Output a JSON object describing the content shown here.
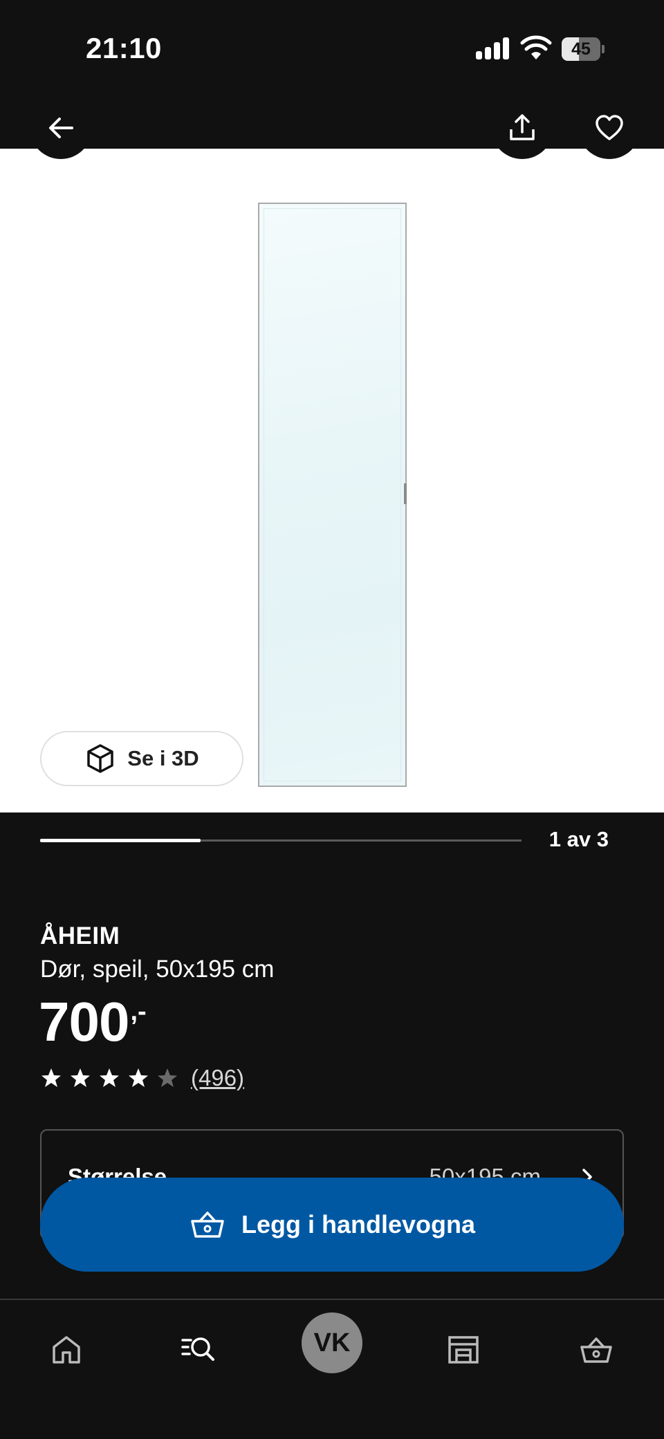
{
  "status_bar": {
    "time": "21:10",
    "battery_level": "45",
    "battery_fraction": 0.45,
    "icons": [
      "signal-icon",
      "wifi-icon",
      "battery-icon"
    ]
  },
  "top_nav": {
    "back_icon": "arrow-left-icon",
    "share_icon": "share-icon",
    "favorite_icon": "heart-icon"
  },
  "gallery": {
    "view_3d_label": "Se i 3D",
    "view_3d_icon": "cube-icon",
    "pager_text": "1 av 3",
    "current_index": 1,
    "total": 3
  },
  "product": {
    "name": "ÅHEIM",
    "description": "Dør, speil, 50x195 cm",
    "price": "700",
    "price_suffix": ",-",
    "rating": 4,
    "rating_max": 5,
    "reviews_count": "(496)"
  },
  "size_selector": {
    "label": "Størrelse",
    "value": "50x195 cm"
  },
  "add_to_cart": {
    "label": "Legg i handlevogna",
    "icon": "basket-icon"
  },
  "bottom_nav": {
    "items": [
      {
        "name": "home-icon"
      },
      {
        "name": "search-icon"
      },
      {
        "name": "avatar",
        "label": "VK"
      },
      {
        "name": "store-icon"
      },
      {
        "name": "cart-icon"
      }
    ]
  },
  "colors": {
    "background": "#111111",
    "accent_blue": "#0058a3",
    "image_bg": "#ffffff"
  }
}
